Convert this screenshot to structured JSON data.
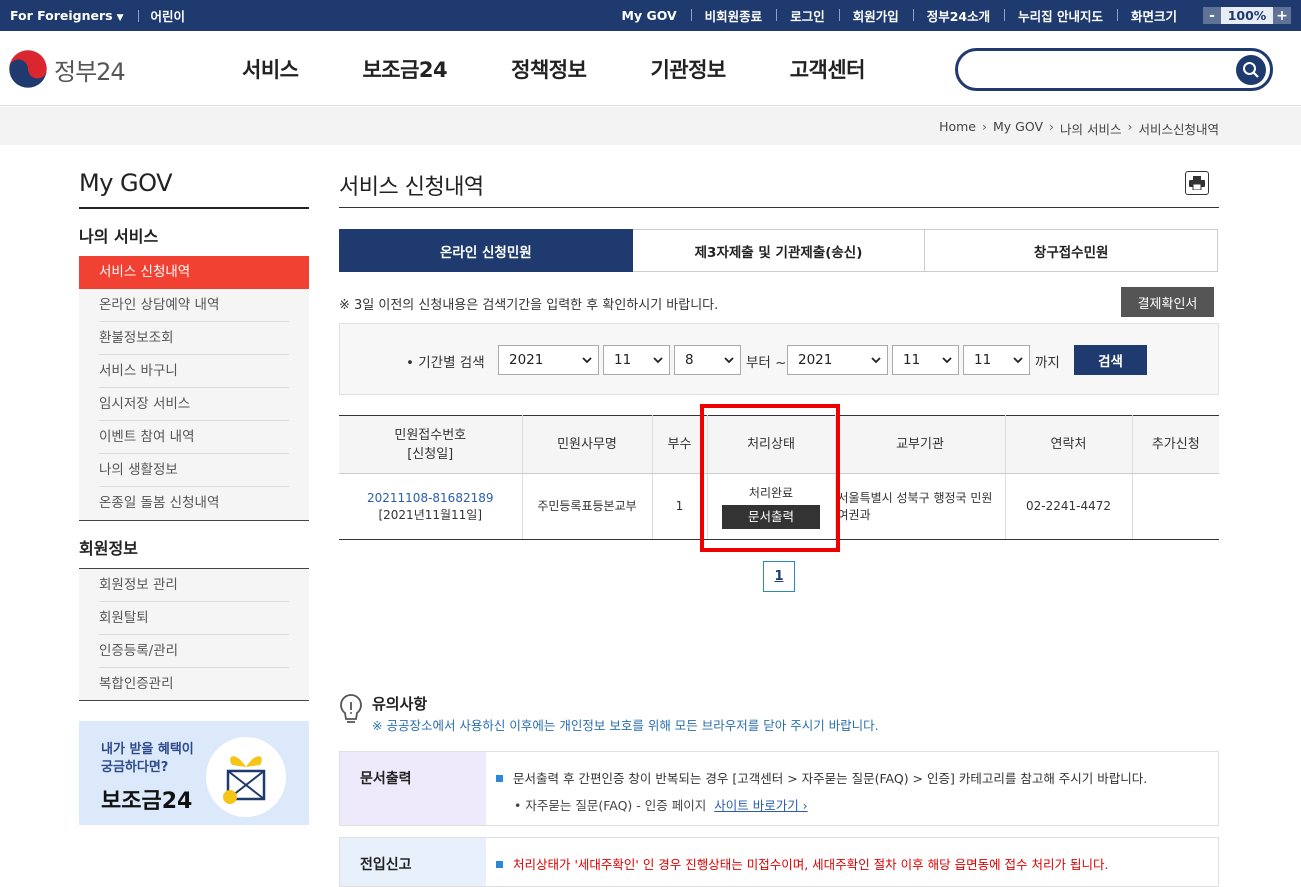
{
  "topbar": {
    "foreigners": "For Foreigners",
    "kids": "어린이",
    "links": [
      "My GOV",
      "비회원종료",
      "로그인",
      "회원가입",
      "정부24소개",
      "누리집 안내지도",
      "화면크기"
    ],
    "zoom_minus": "-",
    "zoom_value": "100%",
    "zoom_plus": "+"
  },
  "header": {
    "logo_text": "정부24",
    "menu": [
      "서비스",
      "보조금24",
      "정책정보",
      "기관정보",
      "고객센터"
    ],
    "search_value": ""
  },
  "breadcrumb": [
    "Home",
    "My GOV",
    "나의 서비스",
    "서비스신청내역"
  ],
  "sidebar": {
    "title": "My GOV",
    "section1": "나의 서비스",
    "items1": [
      "서비스 신청내역",
      "온라인 상담예약 내역",
      "환불정보조회",
      "서비스 바구니",
      "임시저장 서비스",
      "이벤트 참여 내역",
      "나의 생활정보",
      "온종일 돌봄 신청내역"
    ],
    "section2": "회원정보",
    "items2": [
      "회원정보 관리",
      "회원탈퇴",
      "인증등록/관리",
      "복합인증관리"
    ],
    "banner_line1": "내가 받을 혜택이",
    "banner_line2": "궁금하다면?",
    "banner_title": "보조금24"
  },
  "main": {
    "title": "서비스 신청내역",
    "tabs": [
      "온라인 신청민원",
      "제3자제출 및 기관제출(송신)",
      "창구접수민원"
    ],
    "notice": "※ 3일 이전의 신청내용은 검색기간을 입력한 후 확인하시기 바랍니다.",
    "pay_button": "결제확인서",
    "search": {
      "label": "• 기간별 검색",
      "from_year": "2021",
      "from_month": "11",
      "from_day": "8",
      "from_text": "부터 ~",
      "to_year": "2021",
      "to_month": "11",
      "to_day": "11",
      "to_text": "까지",
      "button": "검색"
    },
    "table": {
      "headers": [
        "민원접수번호",
        "[신청일]",
        "민원사무명",
        "부수",
        "처리상태",
        "교부기관",
        "연락처",
        "추가신청"
      ],
      "row": {
        "number": "20211108-81682189",
        "date": "[2021년11월11일]",
        "name": "주민등록표등본교부",
        "copies": "1",
        "status": "처리완료",
        "status_button": "문서출력",
        "agency": "서울특별시 성북구 행정국 민원여권과",
        "contact": "02-2241-4472",
        "extra": ""
      }
    },
    "page": "1",
    "caution": {
      "title": "유의사항",
      "text": "※ 공공장소에서 사용하신 이후에는 개인정보 보호를 위해 모든 브라우저를 닫아 주시기 바랍니다."
    },
    "info1": {
      "label": "문서출력",
      "text": "문서출력 후 간편인증 창이 반복되는 경우 [고객센터 > 자주묻는 질문(FAQ) > 인증] 카테고리를 참고해 주시기 바랍니다.",
      "sub": "• 자주묻는 질문(FAQ) - 인증 페이지",
      "link": "사이트 바로가기"
    },
    "info2": {
      "label": "전입신고",
      "text": "처리상태가 '세대주확인' 인 경우 진행상태는 미접수이며, 세대주확인 절차 이후 해당 읍면동에 접수 처리가 됩니다."
    }
  },
  "colors": {
    "navy": "#1e3a6e",
    "red_active": "#f04132",
    "highlight": "#e00000"
  }
}
